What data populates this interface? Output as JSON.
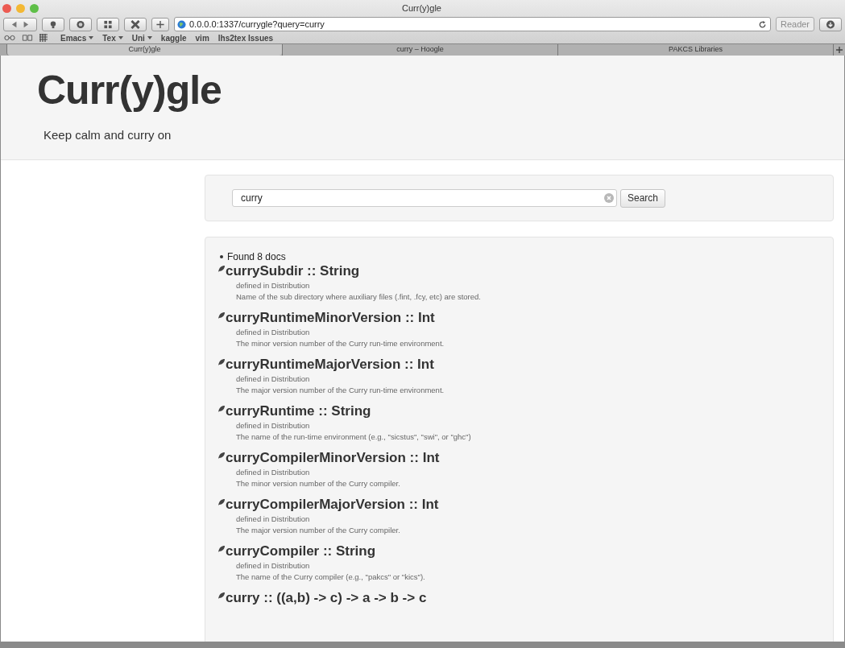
{
  "window": {
    "title": "Curr(y)gle"
  },
  "address_bar": {
    "url": "0.0.0.0:1337/currygle?query=curry"
  },
  "reader_button": {
    "label": "Reader",
    "disabled": true
  },
  "bookmarks": [
    {
      "label": "Emacs",
      "kind": "menu"
    },
    {
      "label": "Tex",
      "kind": "menu"
    },
    {
      "label": "Uni",
      "kind": "menu"
    },
    {
      "label": "kaggle",
      "kind": "link"
    },
    {
      "label": "vim",
      "kind": "link"
    },
    {
      "label": "lhs2tex Issues",
      "kind": "link"
    }
  ],
  "tabs": [
    {
      "label": "Curr(y)gle",
      "selected": true
    },
    {
      "label": "curry – Hoogle",
      "selected": false
    },
    {
      "label": "PAKCS Libraries",
      "selected": false
    }
  ],
  "hero": {
    "title": "Curr(y)gle",
    "tagline": "Keep calm and curry on"
  },
  "search": {
    "value": "curry",
    "button": "Search"
  },
  "results": {
    "summary": "Found 8 docs",
    "items": [
      {
        "signature": "currySubdir :: String",
        "module": "defined in Distribution",
        "description": "Name of the sub directory where auxiliary files (.fint, .fcy, etc) are stored."
      },
      {
        "signature": "curryRuntimeMinorVersion :: Int",
        "module": "defined in Distribution",
        "description": "The minor version number of the Curry run-time environment."
      },
      {
        "signature": "curryRuntimeMajorVersion :: Int",
        "module": "defined in Distribution",
        "description": "The major version number of the Curry run-time environment."
      },
      {
        "signature": "curryRuntime :: String",
        "module": "defined in Distribution",
        "description": "The name of the run-time environment (e.g., \"sicstus\", \"swi\", or \"ghc\")"
      },
      {
        "signature": "curryCompilerMinorVersion :: Int",
        "module": "defined in Distribution",
        "description": "The minor version number of the Curry compiler."
      },
      {
        "signature": "curryCompilerMajorVersion :: Int",
        "module": "defined in Distribution",
        "description": "The major version number of the Curry compiler."
      },
      {
        "signature": "curryCompiler :: String",
        "module": "defined in Distribution",
        "description": "The name of the Curry compiler (e.g., \"pakcs\" or \"kics\")."
      },
      {
        "signature": "curry :: ((a,b) -> c) -> a -> b -> c"
      }
    ]
  }
}
